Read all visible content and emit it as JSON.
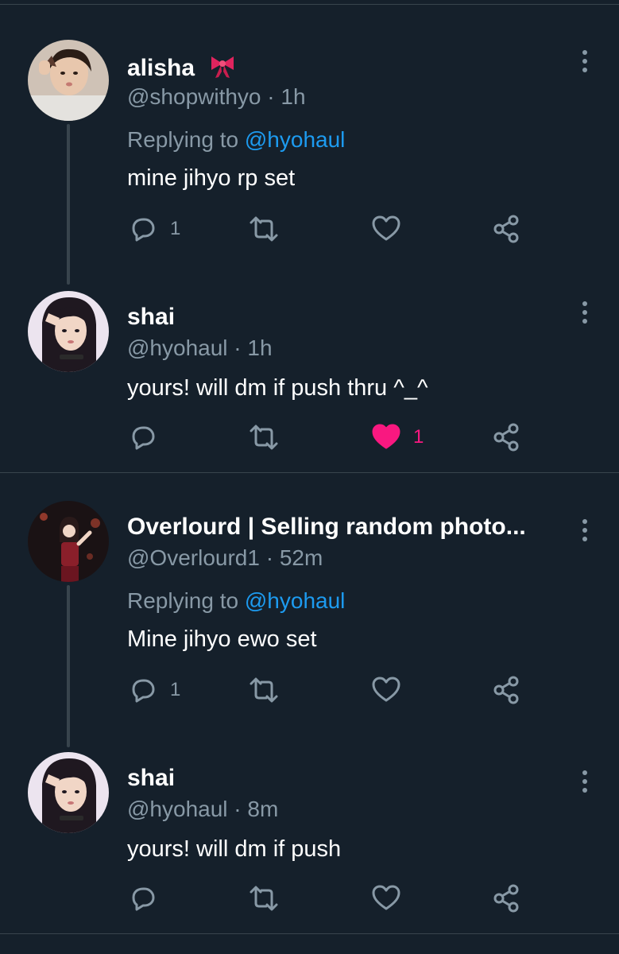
{
  "tweets": [
    {
      "name": "alisha",
      "name_emoji": "ribbon",
      "handle": "@shopwithyo",
      "time": "1h",
      "replying_prefix": "Replying to",
      "replying_to": "@hyohaul",
      "text": "mine jihyo rp set",
      "reply_count": "1",
      "retweet_count": "",
      "like_count": "",
      "liked": false
    },
    {
      "name": "shai",
      "handle": "@hyohaul",
      "time": "1h",
      "text": "yours! will dm if push thru ^_^",
      "reply_count": "",
      "retweet_count": "",
      "like_count": "1",
      "liked": true
    },
    {
      "name": "Overlourd | Selling random photo...",
      "handle": "@Overlourd1",
      "time": "52m",
      "replying_prefix": "Replying to",
      "replying_to": "@hyohaul",
      "text": "Mine jihyo ewo set",
      "reply_count": "1",
      "retweet_count": "",
      "like_count": "",
      "liked": false
    },
    {
      "name": "shai",
      "handle": "@hyohaul",
      "time": "8m",
      "text": "yours! will dm if push",
      "reply_count": "",
      "retweet_count": "",
      "like_count": "",
      "liked": false
    }
  ],
  "separator": "·",
  "colors": {
    "background": "#15202b",
    "secondary_text": "#8899a6",
    "mention": "#1d9bf0",
    "like_active": "#f91880",
    "divider": "#38444d"
  },
  "icons": [
    "reply-icon",
    "retweet-icon",
    "like-icon",
    "share-icon",
    "more-icon",
    "ribbon-icon"
  ]
}
